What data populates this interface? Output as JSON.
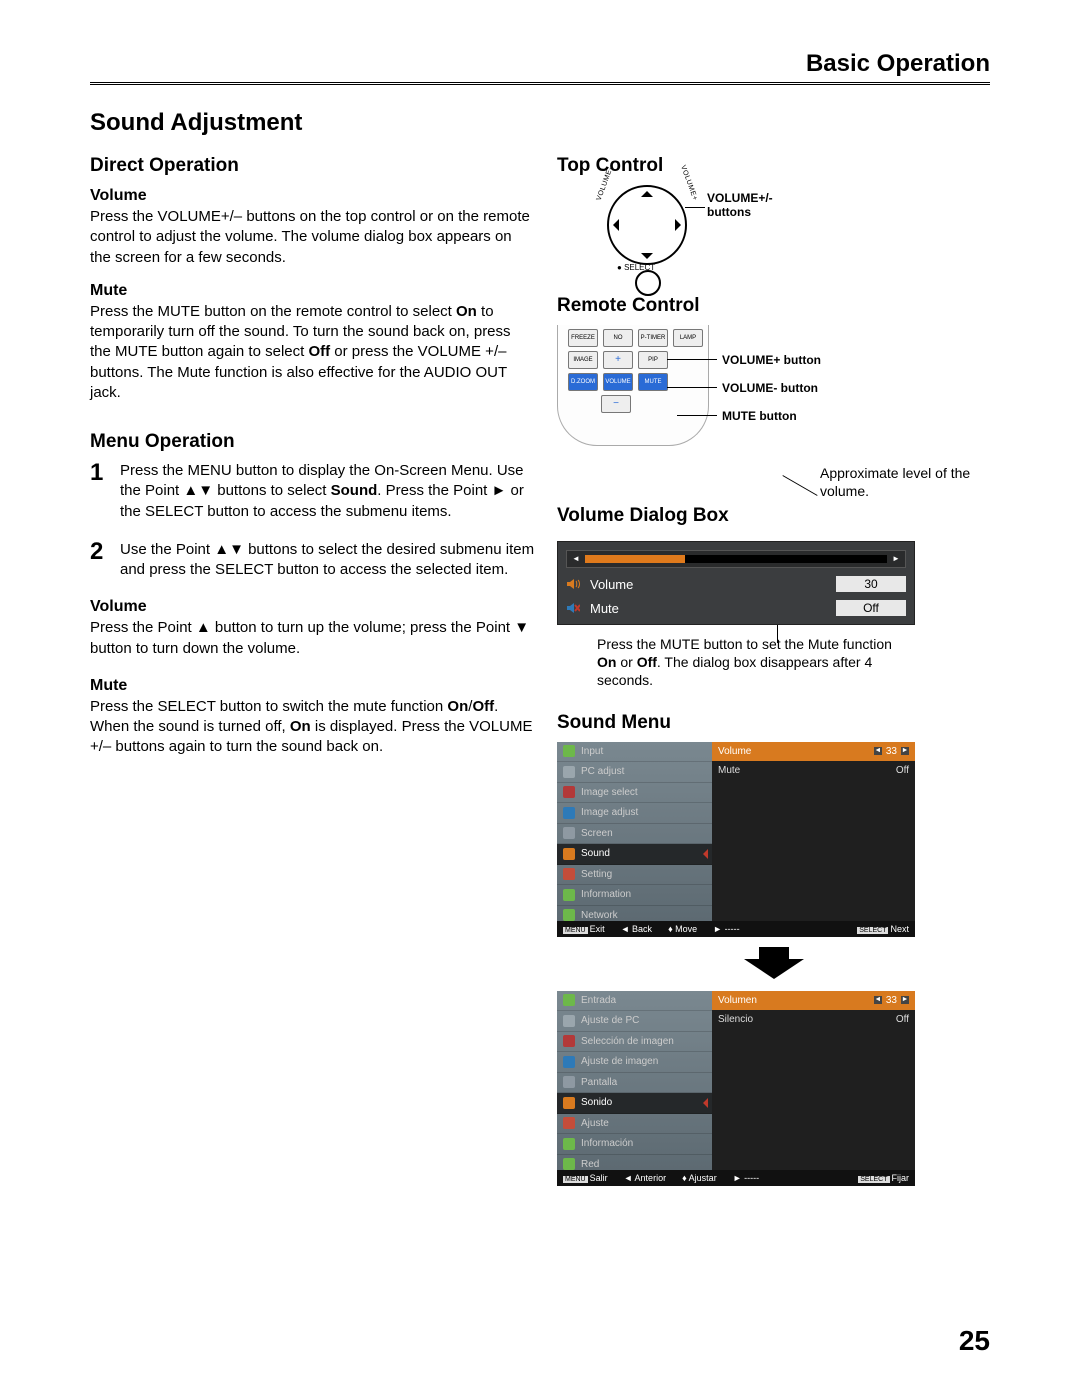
{
  "header": {
    "section": "Basic Operation"
  },
  "title": "Sound Adjustment",
  "page_number": "25",
  "left": {
    "direct_heading": "Direct Operation",
    "vol_heading": "Volume",
    "vol_body": "Press the VOLUME+/– buttons on the top control or on the remote control to adjust the volume. The volume dialog box appears on the screen for a few seconds.",
    "mute_heading": "Mute",
    "mute_body_1": "Press the MUTE button on the remote control to select ",
    "mute_body_on": "On",
    "mute_body_2": " to temporarily turn off the sound. To turn the sound back on, press the MUTE button again to select ",
    "mute_body_off": "Off",
    "mute_body_3": " or press the VOLUME +/– buttons. The Mute function is also effective for the AUDIO OUT jack.",
    "menu_heading": "Menu Operation",
    "step1_a": "Press the MENU button to display the On-Screen Menu. Use the Point ▲▼ buttons to select ",
    "step1_sound": "Sound",
    "step1_b": ". Press the Point ► or the SELECT button to access the submenu items.",
    "step2": "Use the Point ▲▼ buttons to select the desired submenu item and press the SELECT button to access the selected item.",
    "sub_vol_heading": "Volume",
    "sub_vol_body": "Press the Point ▲ button to turn up the volume; press the Point ▼ button to turn down the volume.",
    "sub_mute_heading": "Mute",
    "sub_mute_1": "Press the SELECT button to switch the mute function ",
    "sub_mute_on": "On",
    "sub_mute_slash": "/",
    "sub_mute_off": "Off",
    "sub_mute_2": ". When the sound is turned off, ",
    "sub_mute_on2": "On",
    "sub_mute_3": " is displayed. Press the VOLUME +/– buttons again to turn the sound back on."
  },
  "right": {
    "top_control_heading": "Top Control",
    "top_control_label": "VOLUME+/- buttons",
    "select_label": "SELECT",
    "vol_plus_arc": "VOLUME+",
    "vol_minus_arc": "VOLUME-",
    "remote_heading": "Remote Control",
    "remote_btns_row1": [
      "FREEZE",
      "NO SHOW",
      "P-TIMER",
      "LAMP"
    ],
    "remote_btns_row2": [
      "IMAGE",
      "PIP"
    ],
    "remote_btns_row3": [
      "D.ZOOM",
      "VOLUME",
      "MUTE"
    ],
    "remote_plus": "+",
    "remote_minus": "−",
    "remote_lbl_volplus": "VOLUME+ button",
    "remote_lbl_volminus": "VOLUME- button",
    "remote_lbl_mute": "MUTE button",
    "vol_dialog_heading": "Volume Dialog Box",
    "vol_note_top": "Approximate level of the volume.",
    "vol_dialog": {
      "volume_label": "Volume",
      "volume_value": "30",
      "mute_label": "Mute",
      "mute_value": "Off"
    },
    "vol_note_bottom_1": "Press the MUTE button to set the Mute function ",
    "vol_note_bottom_on": "On",
    "vol_note_bottom_or": " or ",
    "vol_note_bottom_off": "Off",
    "vol_note_bottom_2": ". The dialog box disappears after 4 seconds.",
    "sound_menu_heading": "Sound Menu",
    "osd1": {
      "items": [
        "Input",
        "PC adjust",
        "Image select",
        "Image adjust",
        "Screen",
        "Sound",
        "Setting",
        "Information",
        "Network"
      ],
      "icon_colors": [
        "#6db84a",
        "#9aa6ad",
        "#b33939",
        "#2e7ab8",
        "#8e99a2",
        "#d87a1f",
        "#c44d3a",
        "#6db84a",
        "#6db84a"
      ],
      "selected_index": 5,
      "head_left": "Volume",
      "head_right": "33",
      "row2_left": "Mute",
      "row2_right": "Off",
      "footer": {
        "exit_k": "MENU",
        "exit": "Exit",
        "back": "Back",
        "move": "Move",
        "dashes": "-----",
        "next_k": "SELECT",
        "next": "Next"
      }
    },
    "osd2": {
      "items": [
        "Entrada",
        "Ajuste de PC",
        "Selección de imagen",
        "Ajuste de imagen",
        "Pantalla",
        "Sonido",
        "Ajuste",
        "Información",
        "Red"
      ],
      "icon_colors": [
        "#6db84a",
        "#9aa6ad",
        "#b33939",
        "#2e7ab8",
        "#8e99a2",
        "#d87a1f",
        "#c44d3a",
        "#6db84a",
        "#6db84a"
      ],
      "selected_index": 5,
      "head_left": "Volumen",
      "head_right": "33",
      "row2_left": "Silencio",
      "row2_right": "Off",
      "footer": {
        "exit_k": "MENU",
        "exit": "Salir",
        "back": "Anterior",
        "move": "Ajustar",
        "dashes": "-----",
        "next_k": "SELECT",
        "next": "Fijar"
      }
    }
  }
}
